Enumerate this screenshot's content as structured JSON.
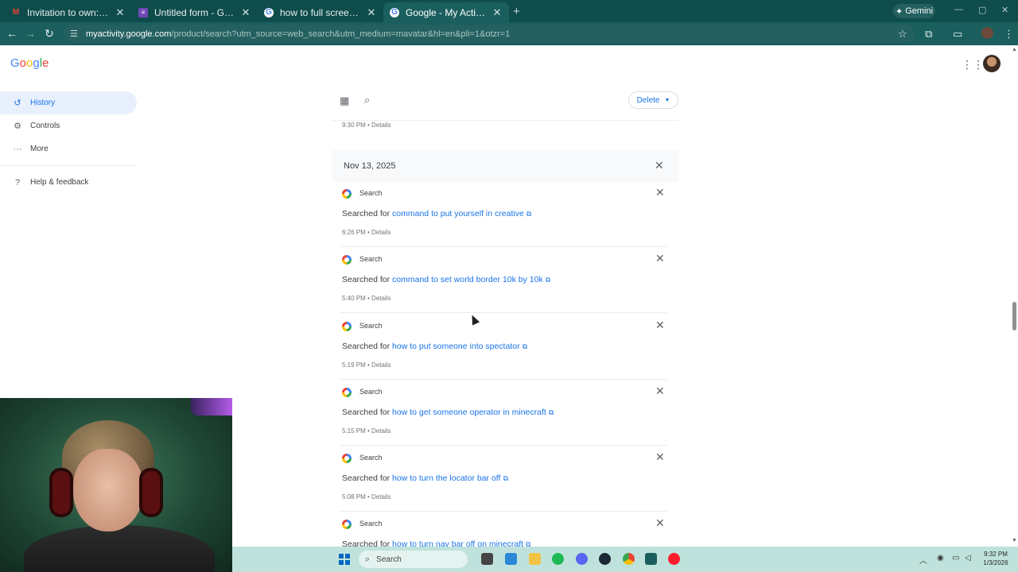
{
  "browser": {
    "tabs": [
      {
        "title": "Invitation to own: \"Untitled form\"",
        "favicon": "gmail-icon",
        "active": false
      },
      {
        "title": "Untitled form - Google Forms",
        "favicon": "forms-icon",
        "active": false
      },
      {
        "title": "how to full screen - Google Search",
        "favicon": "google-icon",
        "active": false
      },
      {
        "title": "Google - My Activity",
        "favicon": "google-icon",
        "active": true
      }
    ],
    "gemini_label": "Gemini",
    "url_domain": "myactivity.google.com",
    "url_path": "/product/search?utm_source=web_search&utm_medium=mavatar&hl=en&pli=1&otzr=1"
  },
  "page": {
    "logo": "Google",
    "sidebar": [
      {
        "label": "History",
        "icon": "history-icon",
        "active": true
      },
      {
        "label": "Controls",
        "icon": "gear-icon",
        "active": false
      },
      {
        "label": "More",
        "icon": "more-icon",
        "active": false
      },
      {
        "label": "Help & feedback",
        "icon": "help-icon",
        "active": false
      }
    ],
    "delete_label": "Delete",
    "previous_meta": "9:30 PM • Details",
    "day_header": "Nov 13, 2025",
    "entries": [
      {
        "product": "Search",
        "prefix": "Searched for ",
        "query": "command to put yourself in creative",
        "meta": "6:26 PM • Details"
      },
      {
        "product": "Search",
        "prefix": "Searched for ",
        "query": "command to set world border 10k by 10k",
        "meta": "5:40 PM • Details"
      },
      {
        "product": "Search",
        "prefix": "Searched for ",
        "query": "how to put someone into spectator",
        "meta": "5:19 PM • Details"
      },
      {
        "product": "Search",
        "prefix": "Searched for ",
        "query": "how to get someone operator in minecraft",
        "meta": "5:15 PM • Details"
      },
      {
        "product": "Search",
        "prefix": "Searched for ",
        "query": "how to turn the locator bar off",
        "meta": "5:08 PM • Details"
      },
      {
        "product": "Search",
        "prefix": "Searched for ",
        "query": "how to turn nav bar off on minecraft",
        "meta": ""
      }
    ]
  },
  "taskbar": {
    "search_placeholder": "Search",
    "time": "9:32 PM",
    "date": "1/3/2026"
  },
  "colors": {
    "chrome_tabbar": "#0f4c4c",
    "chrome_toolbar": "#1a5f5e",
    "link_blue": "#1a73e8",
    "taskbar": "#bfe3dc"
  }
}
